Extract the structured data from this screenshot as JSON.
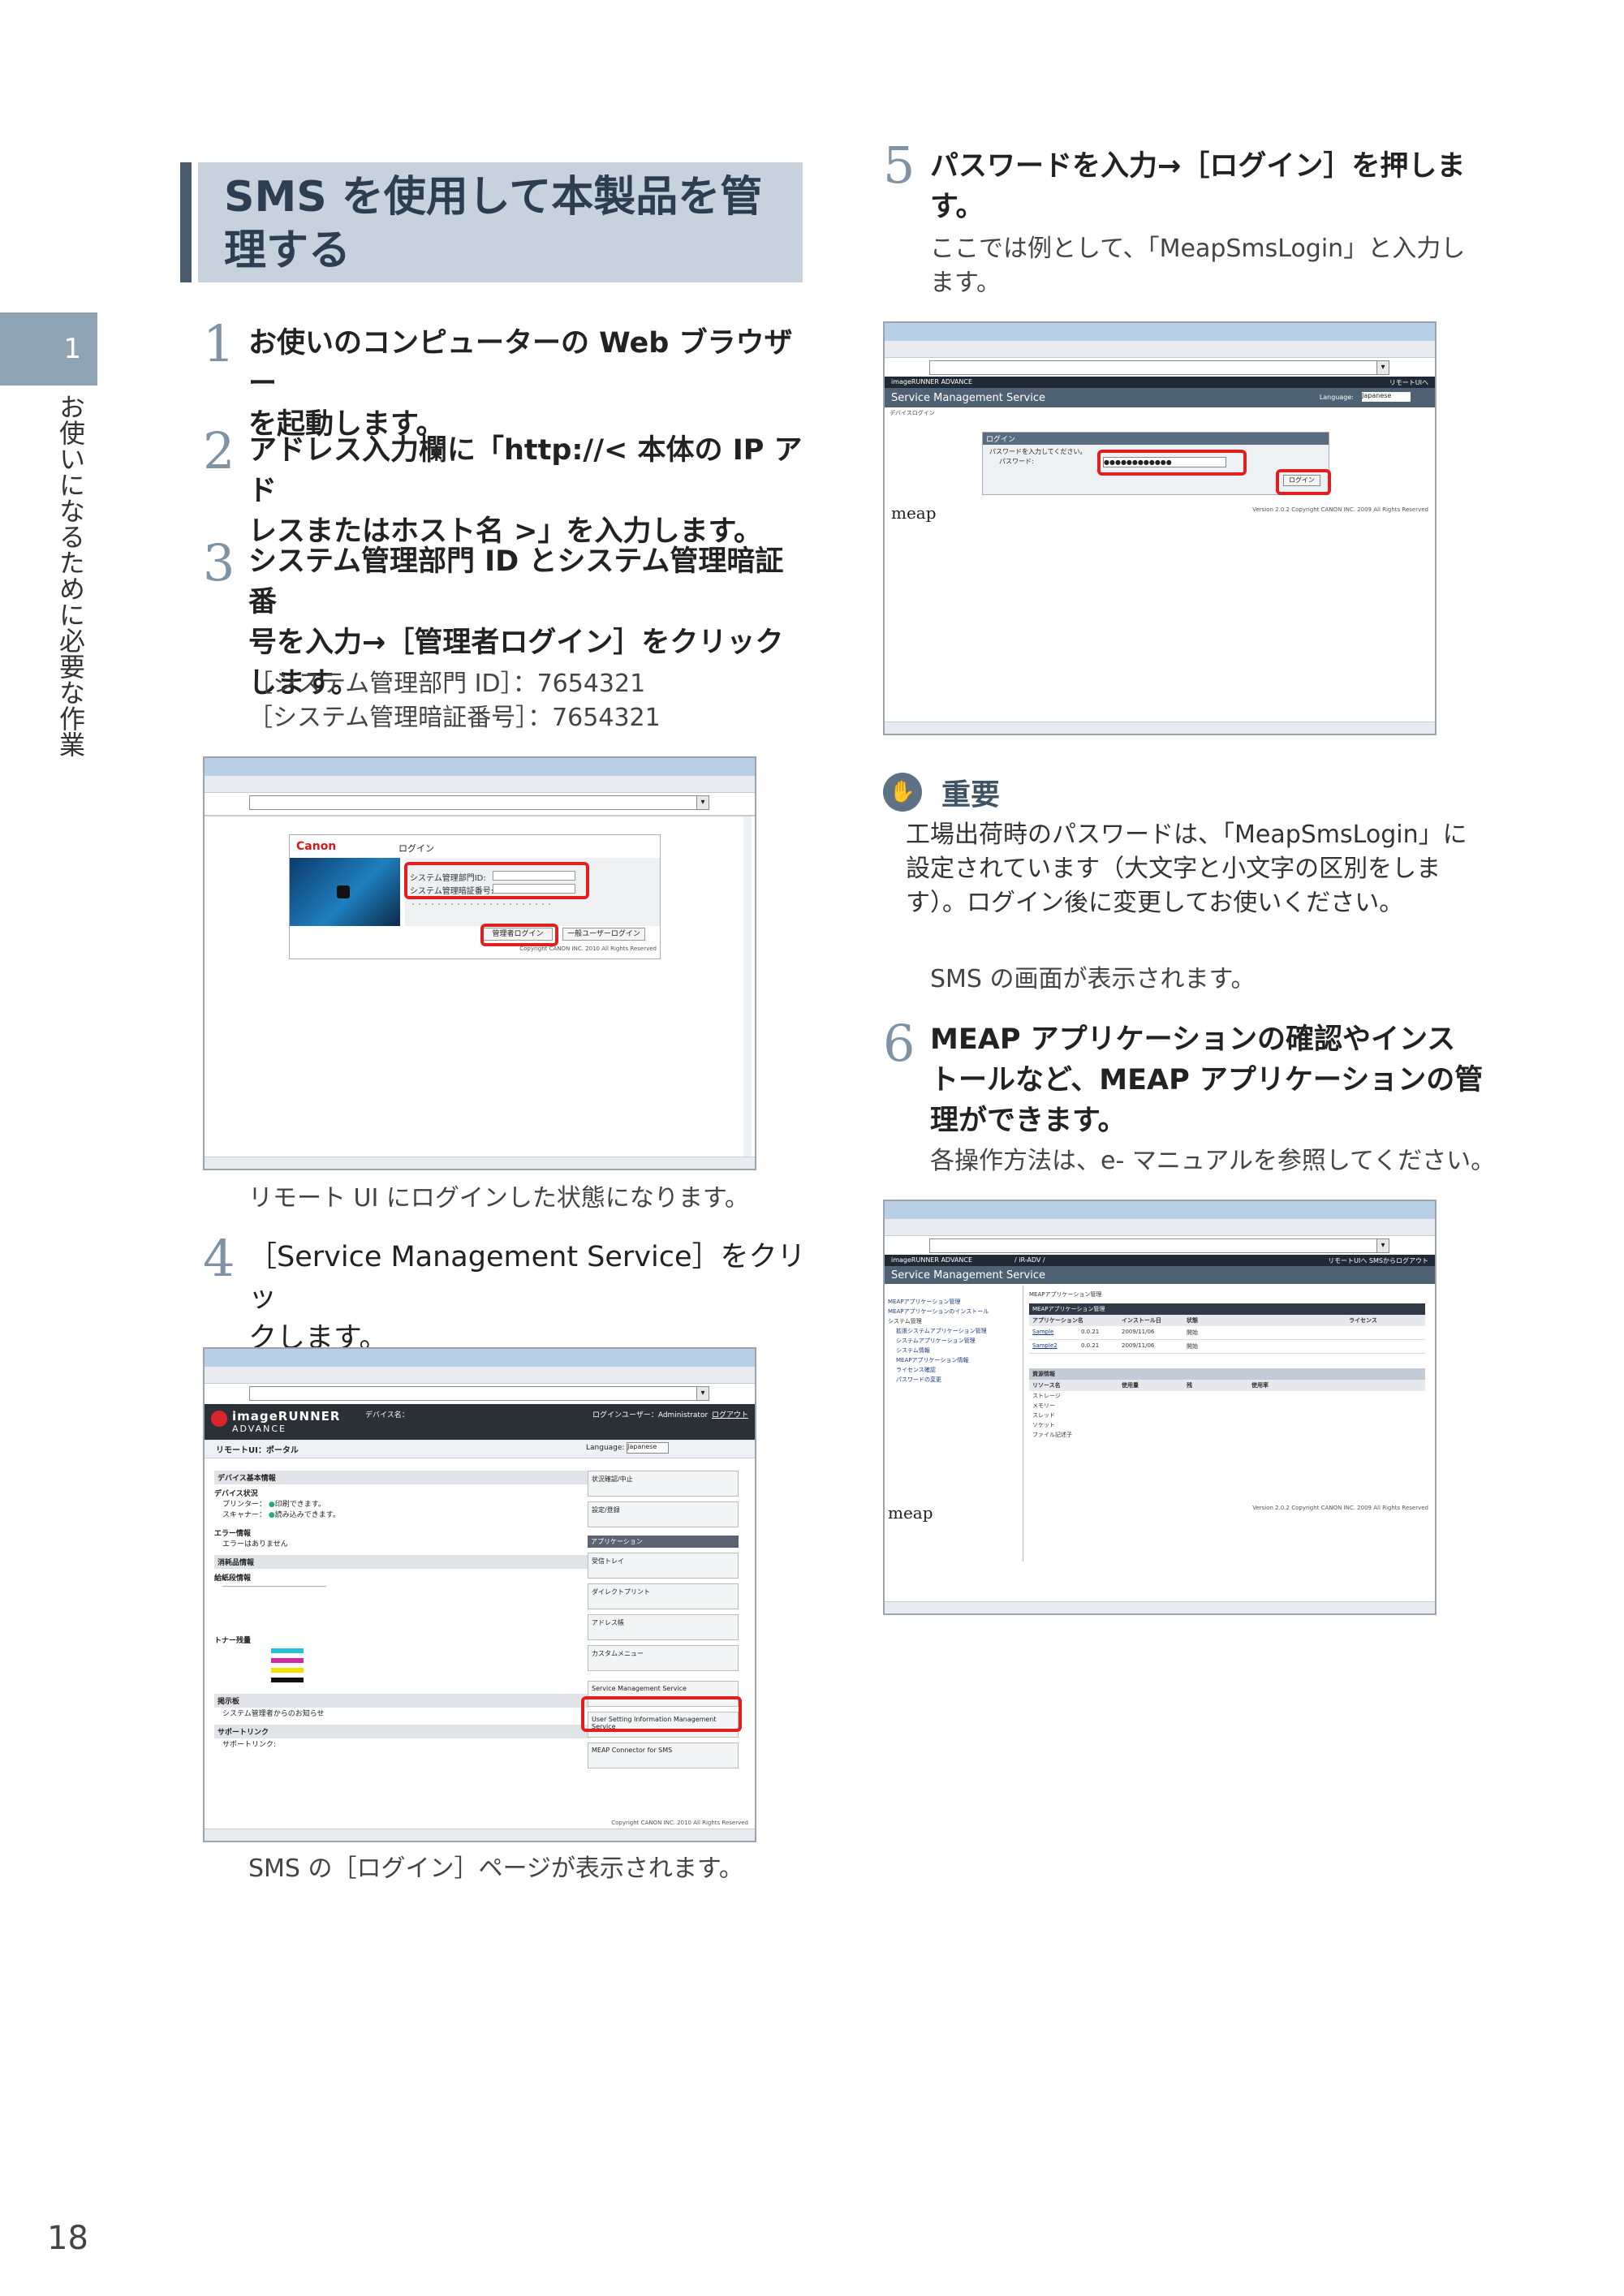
{
  "chapter": {
    "number": "1",
    "title": "お使いになるために必要な作業"
  },
  "page_number": "18",
  "heading": "SMS を使用して本製品を管理する",
  "heading_lines": [
    "SMS を使用して本製品を管",
    "理する"
  ],
  "steps": [
    {
      "num": "1",
      "lines": [
        "お使いのコンピューターの Web ブラウザー",
        "を起動します。"
      ]
    },
    {
      "num": "2",
      "lines": [
        "アドレス入力欄に「http://< 本体の IP アド",
        "レスまたはホスト名 >」を入力します。"
      ]
    },
    {
      "num": "3",
      "lines": [
        "システム管理部門 ID とシステム管理暗証番",
        "号を入力→［管理者ログイン］をクリック",
        "します。"
      ],
      "sub": [
        "［システム管理部門 ID］：7654321",
        "［システム管理暗証番号］：7654321"
      ]
    },
    {
      "num": "4",
      "lines": [
        "［Service Management Service］をクリッ",
        "クします。"
      ]
    },
    {
      "num": "5",
      "lines": [
        "パスワードを入力→［ログイン］を押しま",
        "す。"
      ],
      "sub": [
        "ここでは例として、「MeapSmsLogin」と入力し",
        "ます。"
      ]
    },
    {
      "num": "6",
      "lines": [
        "MEAP アプリケーションの確認やインス",
        "トールなど、MEAP アプリケーションの管",
        "理ができます。"
      ],
      "sub": [
        "各操作方法は、e- マニュアルを参照してください。"
      ]
    }
  ],
  "captions": {
    "after_step3": "リモート UI にログインした状態になります。",
    "after_step4": "SMS の［ログイン］ページが表示されます。",
    "after_important": "SMS の画面が表示されます。"
  },
  "important": {
    "label": "重要",
    "lines": [
      "工場出荷時のパスワードは、「MeapSmsLogin」に",
      "設定されています（大文字と小文字の区別をしま",
      "す）。ログイン後に変更してお使いください。"
    ]
  },
  "shot1": {
    "logo": "Canon",
    "title": "ログイン",
    "field1": "システム管理部門ID:",
    "field2": "システム管理暗証番号:",
    "btn_admin": "管理者ログイン",
    "btn_user": "一般ユーザーログイン",
    "footer": "Copyright CANON INC. 2010 All Rights Reserved"
  },
  "shot2": {
    "brand": "imageRUNNER",
    "brand_sub": "ADVANCE",
    "device_info": "デバイス名：",
    "login_user": "ログインユーザー：Administrator",
    "logout": "ログアウト",
    "portal": "リモートUI：ポータル",
    "language": "Language:",
    "lang_value": "Japanese",
    "section_device": "デバイス基本情報",
    "status": "デバイス状況",
    "printer": "プリンター：",
    "printer_state": "印刷できます。",
    "scanner": "スキャナー：",
    "scanner_state": "読み込みできます。",
    "error_info": "エラー情報",
    "error_text": "エラーはありません",
    "consumables": "消耗品情報",
    "paper": "給紙段情報",
    "toner": "トナー残量",
    "messages": "掲示板",
    "messages_text": "システム管理者からのお知らせ",
    "support": "サポートリンク",
    "support_text": "サポートリンク:",
    "menu": [
      "状況確認/中止",
      "設定/登録"
    ],
    "app_header": "アプリケーション",
    "apps": [
      "受信トレイ",
      "ダイレクトプリント",
      "アドレス帳",
      "カスタムメニュー"
    ],
    "sms_links": [
      "Service Management Service",
      "User Setting Information Management Service",
      "MEAP Connector for SMS"
    ],
    "footer": "Copyright CANON INC. 2010 All Rights Reserved"
  },
  "shot3": {
    "brand": "imageRUNNER ADVANCE",
    "link": "リモートUIへ",
    "title": "Service Management Service",
    "language": "Language:",
    "lang_value": "Japanese",
    "breadcrumb": "デバイスログイン",
    "box_title": "ログイン",
    "prompt": "パスワードを入力してください。",
    "pw_label": "パスワード:",
    "pw_value": "●●●●●●●●●●●●",
    "btn": "ログイン",
    "meap": "meap",
    "footer": "Version 2.0.2 Copyright CANON INC. 2009 All Rights Reserved"
  },
  "shot4": {
    "brand": "imageRUNNER ADVANCE",
    "crumb": "/ iR-ADV /",
    "links": "リモートUIへ  SMSからログアウト",
    "title": "Service Management Service",
    "sidebar": [
      "MEAPアプリケーション管理",
      "MEAPアプリケーションのインストール",
      "システム管理",
      "拡張システムアプリケーション管理",
      "システムアプリケーション管理",
      "システム情報",
      "MEAPアプリケーション情報",
      "ライセンス確認",
      "パスワードの変更"
    ],
    "main_title": "MEAPアプリケーション管理",
    "table_header": "MEAPアプリケーション管理",
    "cols": [
      "アプリケーション名",
      "インストール日",
      "状態",
      "ライセンス"
    ],
    "rows": [
      [
        "Sample",
        "0.0.21",
        "2009/11/06",
        "開始"
      ],
      [
        "Sample2",
        "0.0.21",
        "2009/11/06",
        "開始"
      ]
    ],
    "resource_header": "資源情報",
    "resource_cols": [
      "リソース名",
      "使用量",
      "残",
      "使用率"
    ],
    "resources": [
      "ストレージ",
      "メモリー",
      "スレッド",
      "ソケット",
      "ファイル記述子"
    ],
    "meap": "meap",
    "footer": "Version 2.0.2 Copyright CANON INC. 2009 All Rights Reserved"
  }
}
